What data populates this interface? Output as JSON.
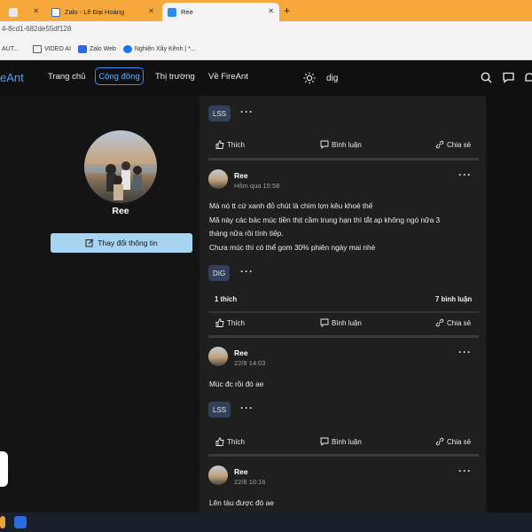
{
  "browser": {
    "tabs": [
      {
        "label": "",
        "active": false
      },
      {
        "label": "Zalo - Lê Đại Hoàng",
        "active": false
      },
      {
        "label": "Ree",
        "active": true
      }
    ],
    "address": "4-8cd1-682de55df128",
    "bookmarks": [
      "AUT...",
      "VIDEO AI",
      "Zalo Web",
      "Nghiện Xây Kênh | *..."
    ]
  },
  "nav": {
    "logo": "eAnt",
    "items": [
      "Trang chủ",
      "Cộng đồng",
      "Thị trường",
      "Về FireAnt"
    ],
    "search_value": "dig"
  },
  "profile": {
    "name": "Ree",
    "edit_label": "Thay đổi thông tin"
  },
  "actions": {
    "like": "Thích",
    "comment": "Bình luận",
    "share": "Chia sẻ"
  },
  "feed": {
    "top_tag": "LSS",
    "posts": [
      {
        "author": "Ree",
        "time": "Hôm qua 15:58",
        "lines": [
          "Má nó tt cứ xanh đỏ chút là chim lợn kêu khoẻ thế",
          "Mã này các bác múc tiền thịt cầm trung hạn thì tắt ap không ngó nữa 3",
          "tháng nữa rồi tính tiếp.",
          "Chưa múc thì có thể gom 30% phiên ngày mai nhé"
        ],
        "tag": "DIG",
        "likes": "1 thích",
        "comments": "7 bình luận"
      },
      {
        "author": "Ree",
        "time": "22/8 14:03",
        "lines": [
          "Múc đc rồi đó ae"
        ],
        "tag": "LSS"
      },
      {
        "author": "Ree",
        "time": "22/8 10:16",
        "lines": [
          "Lên tàu được đó ae"
        ]
      }
    ]
  },
  "colors": {
    "accent": "#3d8bef",
    "tab_bar": "#f6a83a",
    "tag_bg": "#33405a",
    "edit_button": "#a8d4f3"
  }
}
